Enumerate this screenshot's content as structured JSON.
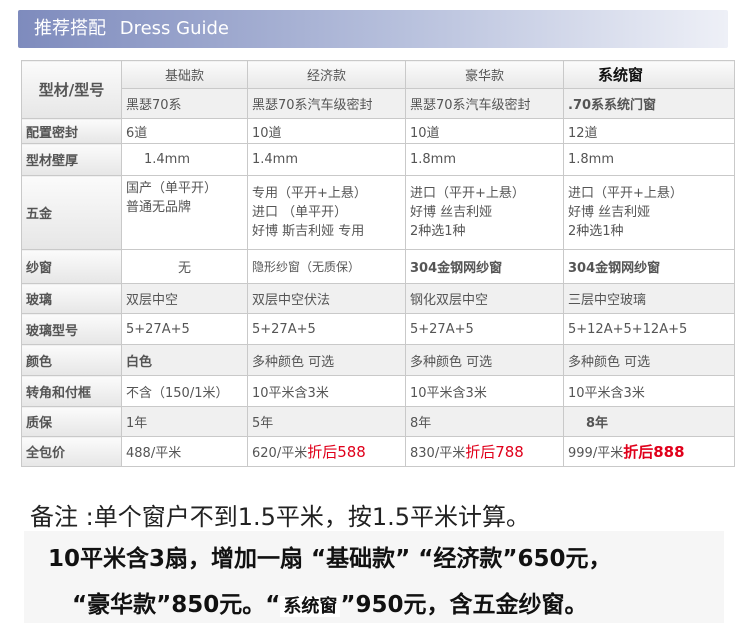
{
  "header": {
    "title_cn": "推荐搭配",
    "title_en": "Dress Guide"
  },
  "table": {
    "corner": "型材/型号",
    "columns": [
      "基础款",
      "经济款",
      "豪华款",
      "系统窗"
    ],
    "models": [
      "黑瑟70系",
      "黑瑟70系汽车级密封",
      "黑瑟70系汽车级密封",
      ".70系系统门窗"
    ],
    "seal": {
      "label": "配置密封",
      "values": [
        "6道",
        "10道",
        "10道",
        "12道"
      ]
    },
    "thickness": {
      "label": "型材壁厚",
      "values": [
        "1.4mm",
        "1.4mm",
        "1.8mm",
        "1.8mm"
      ]
    },
    "hardware": {
      "label": "五金",
      "c1": [
        "国产（单平开）",
        "普通无品牌"
      ],
      "c2": [
        "专用（平开+上悬）",
        "进口 （单平开）",
        "好博 斯吉利娅 专用"
      ],
      "c3": [
        "进口（平开+上悬）",
        "好博 丝吉利娅",
        "2种选1种"
      ],
      "c4": [
        "进口（平开+上悬）",
        "好博 丝吉利娅",
        "2种选1种"
      ]
    },
    "screen": {
      "label": "纱窗",
      "values": [
        "无",
        "隐形纱窗（无质保）",
        "304金钢网纱窗",
        "304金钢网纱窗"
      ]
    },
    "glass": {
      "label": "玻璃",
      "values": [
        "双层中空",
        "双层中空伏法",
        "钢化双层中空",
        "三层中空玻璃"
      ]
    },
    "glass_type": {
      "label": "玻璃型号",
      "values": [
        "5+27A+5",
        "5+27A+5",
        "5+27A+5",
        "5+12A+5+12A+5"
      ]
    },
    "color": {
      "label": "颜色",
      "values": [
        "白色",
        "多种颜色 可选",
        "多种颜色 可选",
        "多种颜色 可选"
      ]
    },
    "frame": {
      "label": "转角和付框",
      "values": [
        "不含（150/1米）",
        "10平米含3米",
        "10平米含3米",
        "10平米含3米"
      ]
    },
    "warranty": {
      "label": "质保",
      "values": [
        "1年",
        "5年",
        "8年",
        "8年"
      ]
    },
    "price": {
      "label": "全包价",
      "values": [
        "488/平米",
        "620/平米",
        "830/平米",
        "999/平米"
      ],
      "discounts": [
        "",
        "折后588",
        "折后788",
        "折后888"
      ]
    }
  },
  "notes": {
    "line1": "备注 :单个窗户不到1.5平米，按1.5平米计算。",
    "line2": "10平米含3扇，增加一扇 “基础款” “经济款”650元，",
    "line3_a": "“豪华款”850元。“",
    "line3_b": "系统窗",
    "line3_c": "”950元，含五金纱窗。"
  },
  "colors": {
    "header_bar": "#7e8bbd",
    "discount_red": "#e0001b"
  }
}
